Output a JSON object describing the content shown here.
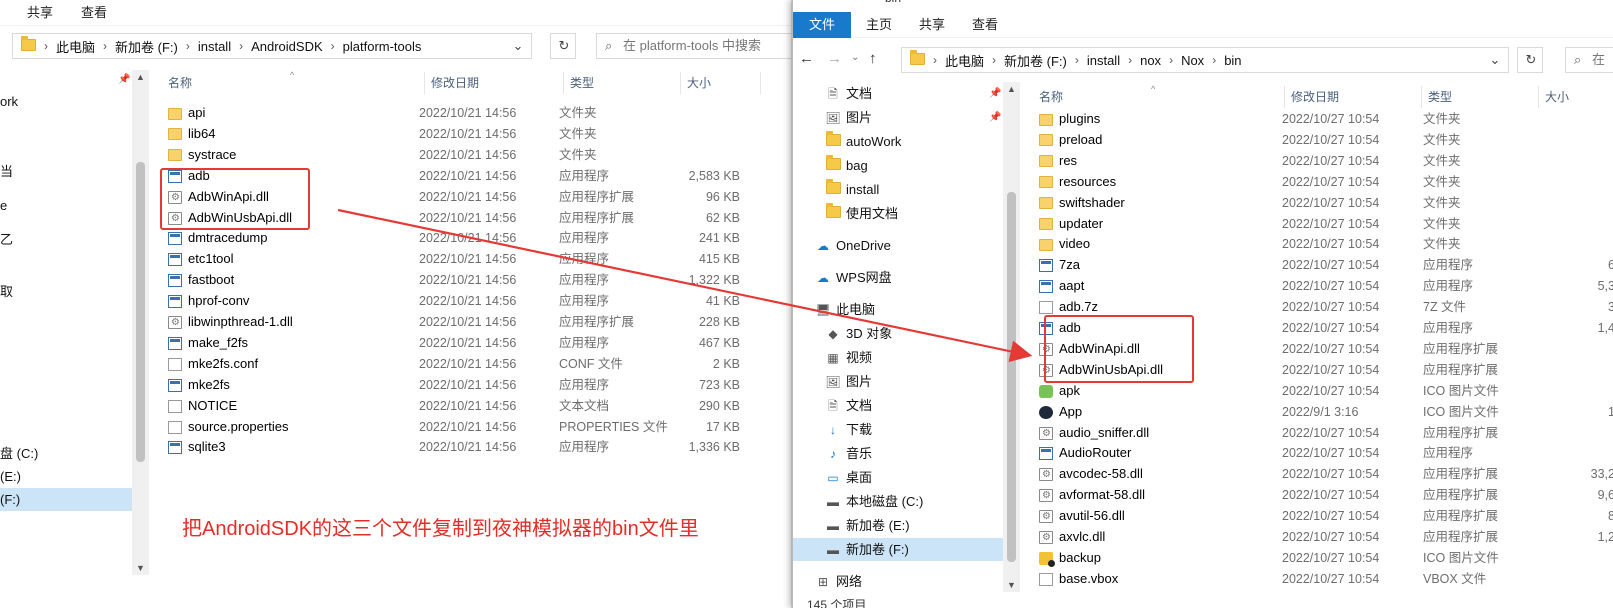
{
  "left": {
    "ribbon_tabs": [
      "共享",
      "查看"
    ],
    "breadcrumb": [
      "此电脑",
      "新加卷 (F:)",
      "install",
      "AndroidSDK",
      "platform-tools"
    ],
    "search_placeholder": "在 platform-tools 中搜索",
    "nav": [
      {
        "label": "ork",
        "icon": "folder-icon"
      },
      {
        "label": "当",
        "icon": "folder-icon"
      },
      {
        "label": "e",
        "icon": "folder-icon"
      },
      {
        "label": "乙",
        "icon": "folder-icon"
      },
      {
        "label": "取",
        "icon": "folder-icon"
      },
      {
        "label": "盘 (C:)",
        "icon": "drive-icon"
      },
      {
        "label": "(E:)",
        "icon": "drive-icon"
      },
      {
        "label": "(F:)",
        "icon": "drive-icon"
      }
    ],
    "columns": {
      "name": "名称",
      "date": "修改日期",
      "type": "类型",
      "size": "大小"
    },
    "files": [
      {
        "name": "api",
        "date": "2022/10/21 14:56",
        "type": "文件夹",
        "size": "",
        "icon": "folder"
      },
      {
        "name": "lib64",
        "date": "2022/10/21 14:56",
        "type": "文件夹",
        "size": "",
        "icon": "folder"
      },
      {
        "name": "systrace",
        "date": "2022/10/21 14:56",
        "type": "文件夹",
        "size": "",
        "icon": "folder"
      },
      {
        "name": "adb",
        "date": "2022/10/21 14:56",
        "type": "应用程序",
        "size": "2,583 KB",
        "icon": "exe"
      },
      {
        "name": "AdbWinApi.dll",
        "date": "2022/10/21 14:56",
        "type": "应用程序扩展",
        "size": "96 KB",
        "icon": "dll"
      },
      {
        "name": "AdbWinUsbApi.dll",
        "date": "2022/10/21 14:56",
        "type": "应用程序扩展",
        "size": "62 KB",
        "icon": "dll"
      },
      {
        "name": "dmtracedump",
        "date": "2022/10/21 14:56",
        "type": "应用程序",
        "size": "241 KB",
        "icon": "exe"
      },
      {
        "name": "etc1tool",
        "date": "2022/10/21 14:56",
        "type": "应用程序",
        "size": "415 KB",
        "icon": "exe"
      },
      {
        "name": "fastboot",
        "date": "2022/10/21 14:56",
        "type": "应用程序",
        "size": "1,322 KB",
        "icon": "exe"
      },
      {
        "name": "hprof-conv",
        "date": "2022/10/21 14:56",
        "type": "应用程序",
        "size": "41 KB",
        "icon": "exe"
      },
      {
        "name": "libwinpthread-1.dll",
        "date": "2022/10/21 14:56",
        "type": "应用程序扩展",
        "size": "228 KB",
        "icon": "dll"
      },
      {
        "name": "make_f2fs",
        "date": "2022/10/21 14:56",
        "type": "应用程序",
        "size": "467 KB",
        "icon": "exe"
      },
      {
        "name": "mke2fs.conf",
        "date": "2022/10/21 14:56",
        "type": "CONF 文件",
        "size": "2 KB",
        "icon": "doc"
      },
      {
        "name": "mke2fs",
        "date": "2022/10/21 14:56",
        "type": "应用程序",
        "size": "723 KB",
        "icon": "exe"
      },
      {
        "name": "NOTICE",
        "date": "2022/10/21 14:56",
        "type": "文本文档",
        "size": "290 KB",
        "icon": "doc"
      },
      {
        "name": "source.properties",
        "date": "2022/10/21 14:56",
        "type": "PROPERTIES 文件",
        "size": "17 KB",
        "icon": "doc"
      },
      {
        "name": "sqlite3",
        "date": "2022/10/21 14:56",
        "type": "应用程序",
        "size": "1,336 KB",
        "icon": "exe"
      }
    ],
    "annotation": "把AndroidSDK的这三个文件复制到夜神模拟器的bin文件里"
  },
  "right": {
    "title": "bin",
    "ribbon_tabs": [
      "文件",
      "主页",
      "共享",
      "查看"
    ],
    "breadcrumb": [
      "此电脑",
      "新加卷 (F:)",
      "install",
      "nox",
      "Nox",
      "bin"
    ],
    "search_placeholder": "在",
    "nav": [
      {
        "label": "文档",
        "icon": "document-icon",
        "pin": true
      },
      {
        "label": "图片",
        "icon": "picture-icon",
        "pin": true
      },
      {
        "label": "autoWork",
        "icon": "folder-icon"
      },
      {
        "label": "bag",
        "icon": "folder-icon"
      },
      {
        "label": "install",
        "icon": "folder-icon"
      },
      {
        "label": "使用文档",
        "icon": "folder-icon"
      },
      {
        "label": "OneDrive",
        "icon": "cloud-icon"
      },
      {
        "label": "WPS网盘",
        "icon": "cloud-icon"
      },
      {
        "label": "此电脑",
        "icon": "computer-icon"
      },
      {
        "label": "3D 对象",
        "icon": "cube-icon"
      },
      {
        "label": "视频",
        "icon": "video-icon"
      },
      {
        "label": "图片",
        "icon": "picture-icon"
      },
      {
        "label": "文档",
        "icon": "document-icon"
      },
      {
        "label": "下载",
        "icon": "download-icon"
      },
      {
        "label": "音乐",
        "icon": "music-icon"
      },
      {
        "label": "桌面",
        "icon": "desktop-icon"
      },
      {
        "label": "本地磁盘 (C:)",
        "icon": "drive-icon"
      },
      {
        "label": "新加卷 (E:)",
        "icon": "drive-icon"
      },
      {
        "label": "新加卷 (F:)",
        "icon": "drive-icon"
      },
      {
        "label": "网络",
        "icon": "network-icon"
      }
    ],
    "columns": {
      "name": "名称",
      "date": "修改日期",
      "type": "类型",
      "size": "大小"
    },
    "files": [
      {
        "name": "plugins",
        "date": "2022/10/27 10:54",
        "type": "文件夹",
        "size": "",
        "icon": "folder"
      },
      {
        "name": "preload",
        "date": "2022/10/27 10:54",
        "type": "文件夹",
        "size": "",
        "icon": "folder"
      },
      {
        "name": "res",
        "date": "2022/10/27 10:54",
        "type": "文件夹",
        "size": "",
        "icon": "folder"
      },
      {
        "name": "resources",
        "date": "2022/10/27 10:54",
        "type": "文件夹",
        "size": "",
        "icon": "folder"
      },
      {
        "name": "swiftshader",
        "date": "2022/10/27 10:54",
        "type": "文件夹",
        "size": "",
        "icon": "folder"
      },
      {
        "name": "updater",
        "date": "2022/10/27 10:54",
        "type": "文件夹",
        "size": "",
        "icon": "folder"
      },
      {
        "name": "video",
        "date": "2022/10/27 10:54",
        "type": "文件夹",
        "size": "",
        "icon": "folder"
      },
      {
        "name": "7za",
        "date": "2022/10/27 10:54",
        "type": "应用程序",
        "size": "6",
        "icon": "exe"
      },
      {
        "name": "aapt",
        "date": "2022/10/27 10:54",
        "type": "应用程序",
        "size": "5,3",
        "icon": "exe"
      },
      {
        "name": "adb.7z",
        "date": "2022/10/27 10:54",
        "type": "7Z 文件",
        "size": "3",
        "icon": "doc"
      },
      {
        "name": "adb",
        "date": "2022/10/27 10:54",
        "type": "应用程序",
        "size": "1,4",
        "icon": "exe"
      },
      {
        "name": "AdbWinApi.dll",
        "date": "2022/10/27 10:54",
        "type": "应用程序扩展",
        "size": "",
        "icon": "dll"
      },
      {
        "name": "AdbWinUsbApi.dll",
        "date": "2022/10/27 10:54",
        "type": "应用程序扩展",
        "size": "",
        "icon": "dll"
      },
      {
        "name": "apk",
        "date": "2022/10/27 10:54",
        "type": "ICO 图片文件",
        "size": "",
        "icon": "ico-apk"
      },
      {
        "name": "App",
        "date": "2022/9/1 3:16",
        "type": "ICO 图片文件",
        "size": "1",
        "icon": "ico-app"
      },
      {
        "name": "audio_sniffer.dll",
        "date": "2022/10/27 10:54",
        "type": "应用程序扩展",
        "size": "",
        "icon": "dll"
      },
      {
        "name": "AudioRouter",
        "date": "2022/10/27 10:54",
        "type": "应用程序",
        "size": "",
        "icon": "exe"
      },
      {
        "name": "avcodec-58.dll",
        "date": "2022/10/27 10:54",
        "type": "应用程序扩展",
        "size": "33,2",
        "icon": "dll"
      },
      {
        "name": "avformat-58.dll",
        "date": "2022/10/27 10:54",
        "type": "应用程序扩展",
        "size": "9,6",
        "icon": "dll"
      },
      {
        "name": "avutil-56.dll",
        "date": "2022/10/27 10:54",
        "type": "应用程序扩展",
        "size": "8",
        "icon": "dll"
      },
      {
        "name": "axvlc.dll",
        "date": "2022/10/27 10:54",
        "type": "应用程序扩展",
        "size": "1,2",
        "icon": "dll"
      },
      {
        "name": "backup",
        "date": "2022/10/27 10:54",
        "type": "ICO 图片文件",
        "size": "",
        "icon": "ico-backup"
      },
      {
        "name": "base.vbox",
        "date": "2022/10/27 10:54",
        "type": "VBOX 文件",
        "size": "",
        "icon": "doc"
      }
    ],
    "status": "145 个项目"
  },
  "colors": {
    "accent": "#1979ca",
    "highlight_box": "#e53935",
    "annotation": "#e52d27",
    "selected": "#cce4f7"
  }
}
